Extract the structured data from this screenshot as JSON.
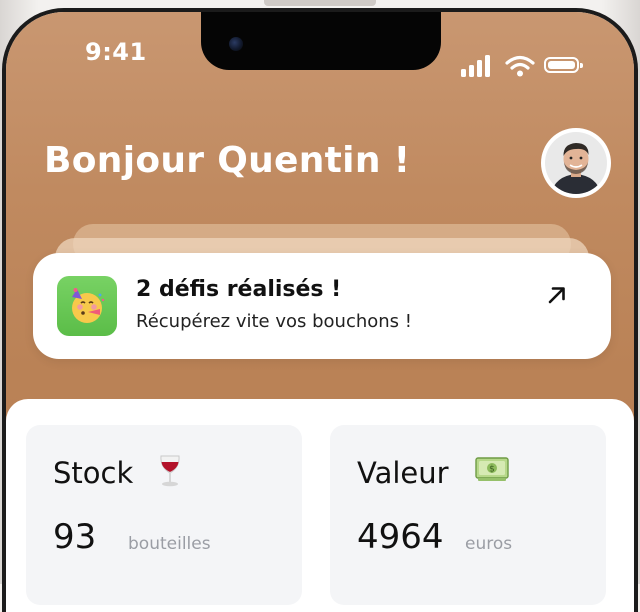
{
  "status_bar": {
    "time": "9:41"
  },
  "header": {
    "greeting": "Bonjour Quentin !"
  },
  "notification": {
    "title": "2 défis réalisés !",
    "subtitle": "Récupérez vite vos bouchons !",
    "icon": "party-face-icon",
    "action_icon": "arrow-up-right-icon"
  },
  "stats": {
    "stock": {
      "label": "Stock",
      "emoji": "wine-glass-icon",
      "value": "93",
      "unit": "bouteilles"
    },
    "valeur": {
      "label": "Valeur",
      "emoji": "money-bill-icon",
      "value": "4964",
      "unit": "euros"
    }
  },
  "colors": {
    "header_background": "#c08a60",
    "notif_icon_background": "#5bbd48",
    "card_background": "#f4f5f7",
    "unit_text": "#9a9da4"
  }
}
